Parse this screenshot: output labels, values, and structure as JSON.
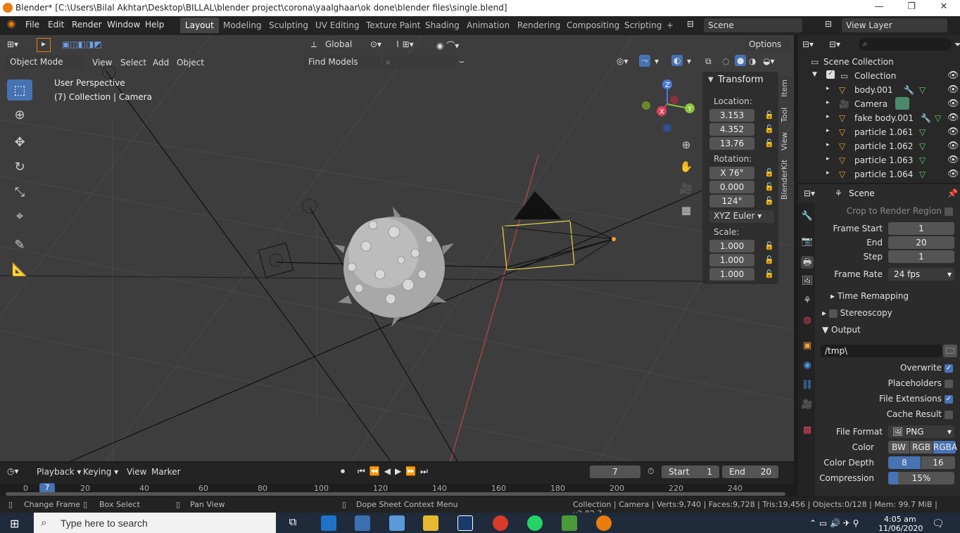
{
  "window": {
    "title": "Blender* [C:\\Users\\Bilal Akhtar\\Desktop\\BILLAL\\blender project\\corona\\yaalghaar\\ok done\\blender files\\single.blend]"
  },
  "menu": {
    "file": "File",
    "edit": "Edit",
    "render": "Render",
    "window": "Window",
    "help": "Help"
  },
  "workspaces": [
    "Layout",
    "Modeling",
    "Sculpting",
    "UV Editing",
    "Texture Paint",
    "Shading",
    "Animation",
    "Rendering",
    "Compositing",
    "Scripting"
  ],
  "workspace_add": "+",
  "scene_field": "Scene",
  "view_layer_field": "View Layer",
  "viewport": {
    "transform_orientation": "Global",
    "options": "Options",
    "mode": "Object Mode",
    "menus": {
      "view": "View",
      "select": "Select",
      "add": "Add",
      "object": "Object"
    },
    "find_models": "Find Models",
    "overlay_text_1": "User Perspective",
    "overlay_text_2": "(7) Collection | Camera",
    "gizmo": {
      "z": "Z",
      "x": "X",
      "y": "Y"
    }
  },
  "npanel": {
    "header": "Transform",
    "location_label": "Location:",
    "location": [
      "3.153",
      "4.352",
      "13.76"
    ],
    "rotation_label": "Rotation:",
    "rotation": [
      "X  76°",
      "0.000",
      "124°"
    ],
    "rotation_mode": "XYZ Euler",
    "scale_label": "Scale:",
    "scale": [
      "1.000",
      "1.000",
      "1.000"
    ],
    "tabs": [
      "Item",
      "Tool",
      "View",
      "BlenderKit"
    ]
  },
  "outliner": {
    "root": "Scene Collection",
    "collection": "Collection",
    "items": [
      "body.001",
      "Camera",
      "fake body.001",
      "particle 1.061",
      "particle 1.062",
      "particle 1.063",
      "particle 1.064"
    ]
  },
  "properties": {
    "context": "Scene",
    "crop_label": "Crop to Render Region",
    "frame_start_label": "Frame Start",
    "frame_start": "1",
    "end_label": "End",
    "end": "20",
    "step_label": "Step",
    "step": "1",
    "frame_rate_label": "Frame Rate",
    "frame_rate": "24 fps",
    "time_remapping": "Time Remapping",
    "stereoscopy": "Stereoscopy",
    "output": "Output",
    "output_path": "/tmp\\",
    "overwrite": "Overwrite",
    "placeholders": "Placeholders",
    "file_extensions": "File Extensions",
    "cache_result": "Cache Result",
    "file_format_label": "File Format",
    "file_format": "PNG",
    "color_label": "Color",
    "color_modes": [
      "BW",
      "RGB",
      "RGBA"
    ],
    "color_depth_label": "Color Depth",
    "color_depths": [
      "8",
      "16"
    ],
    "compression_label": "Compression",
    "compression": "15%",
    "compression_fraction": 0.15
  },
  "timeline": {
    "playback": "Playback",
    "keying": "Keying",
    "view": "View",
    "marker": "Marker",
    "current_frame": "7",
    "start_label": "Start",
    "start": "1",
    "end_label": "End",
    "end": "20",
    "ruler": [
      "0",
      "7",
      "20",
      "40",
      "60",
      "80",
      "100",
      "120",
      "140",
      "160",
      "180",
      "200",
      "220",
      "240"
    ]
  },
  "status": {
    "change_frame": "Change Frame",
    "box_select": "Box Select",
    "pan_view": "Pan View",
    "context_menu": "Dope Sheet Context Menu",
    "stats": "Collection | Camera | Verts:9,740 | Faces:9,728 | Tris:19,456 | Objects:0/128 | Mem: 99.7 MiB | v2.82.7"
  },
  "taskbar": {
    "search_placeholder": "Type here to search",
    "time": "4:05 am",
    "date": "11/06/2020"
  },
  "colors": {
    "accent": "#4772b3",
    "orange": "#e87d0d",
    "viewport_bg": "#3d3d3d",
    "panel_bg": "#2b2b2b"
  }
}
